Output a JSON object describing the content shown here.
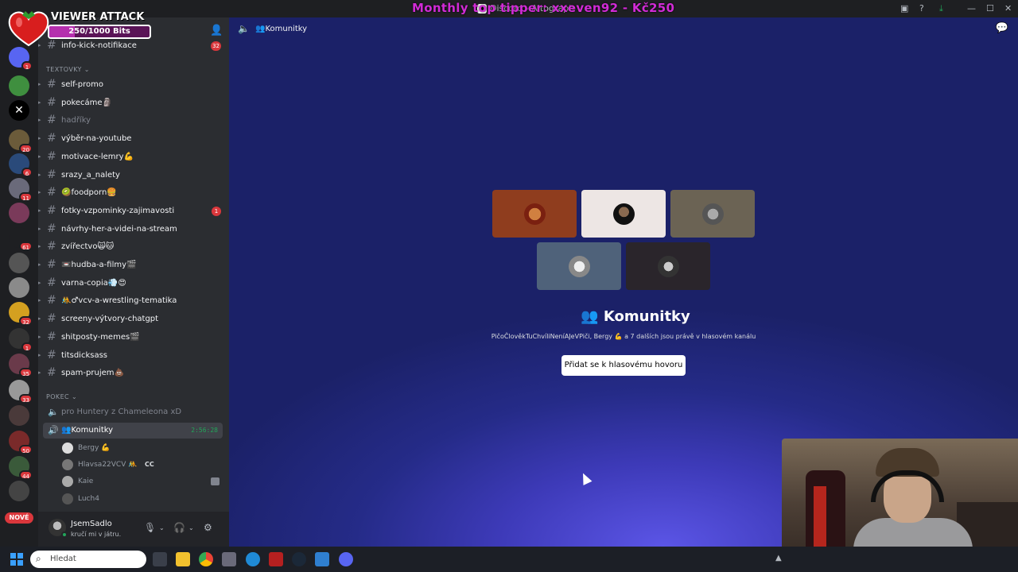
{
  "window": {
    "title": "Discord - Altograph",
    "tip_overlay": "Monthly top tipper: xxeven92 - Kč250",
    "controls": [
      "▣",
      "?",
      "⤓",
      "—",
      "☐",
      "✕"
    ]
  },
  "viewer_attack": {
    "title": "VIEWER ATTACK",
    "progress_text": "250/1000 Bits",
    "progress": 0.25
  },
  "server_rail": {
    "badges": [
      "1",
      "20",
      "6",
      "11",
      "61",
      "32",
      "1",
      "35",
      "33",
      "50",
      "44"
    ],
    "new_label": "NOVÉ"
  },
  "sidebar": {
    "top_channel": {
      "name": "info-kick-notifikace",
      "badge": "32"
    },
    "categories": {
      "text": "TEXTOVKY ⌄",
      "voice": "POKEC ⌄"
    },
    "text_channels": [
      {
        "name": "self-promo",
        "muted": false
      },
      {
        "name": "pokecáme🗿",
        "muted": false
      },
      {
        "name": "hadříky",
        "muted": true
      },
      {
        "name": "výběr-na-youtube",
        "muted": false
      },
      {
        "name": "motivace-lemry💪",
        "muted": false
      },
      {
        "name": "srazy_a_nalety",
        "muted": false
      },
      {
        "name": "🥝foodporn🍔",
        "muted": false
      },
      {
        "name": "fotky-vzpominky-zajimavosti",
        "muted": false,
        "badge": "1"
      },
      {
        "name": "návrhy-her-a-videi-na-stream",
        "muted": false
      },
      {
        "name": "zvířectvo🙀🐱",
        "muted": false
      },
      {
        "name": "📼hudba-a-filmy🎬",
        "muted": false
      },
      {
        "name": "varna-copia💨😍",
        "muted": false
      },
      {
        "name": "🤼♂vcv-a-wrestling-tematika",
        "muted": false
      },
      {
        "name": "screeny-výtvory-chatgpt",
        "muted": false
      },
      {
        "name": "shitposty-memes🎬",
        "muted": false
      },
      {
        "name": "titsdicksass",
        "muted": false
      },
      {
        "name": "spam-prujem💩",
        "muted": false
      }
    ],
    "voice_channels": [
      {
        "name": "pro Huntery z Chameleona xD",
        "active": false
      },
      {
        "name": "👥Komunitky",
        "active": true,
        "timer": "2:56:28"
      }
    ],
    "voice_users": [
      {
        "name": "Bergy 💪",
        "cc": ""
      },
      {
        "name": "Hlavsa22VCV 🤼",
        "cc": "CC"
      },
      {
        "name": "Kaie",
        "cc": ""
      },
      {
        "name": "Luch4",
        "cc": ""
      }
    ],
    "user": {
      "name": "JsemSadlo",
      "status": "kručí mi v játru."
    }
  },
  "main": {
    "header_title": "👥Komunitky",
    "voice_title": "👥 Komunitky",
    "description": "PičoČlověkTuChvíliNeníAJeVPiči, Bergy 💪 a 7 dalších jsou právě v hlasovém kanálu",
    "join_label": "Přidat se k hlasovému hovoru"
  },
  "taskbar": {
    "search_placeholder": "Hledat"
  },
  "colors": {
    "accent": "#5865f2",
    "online": "#23a55a",
    "badge": "#da373c",
    "overlay_text": "#d12bd6"
  }
}
